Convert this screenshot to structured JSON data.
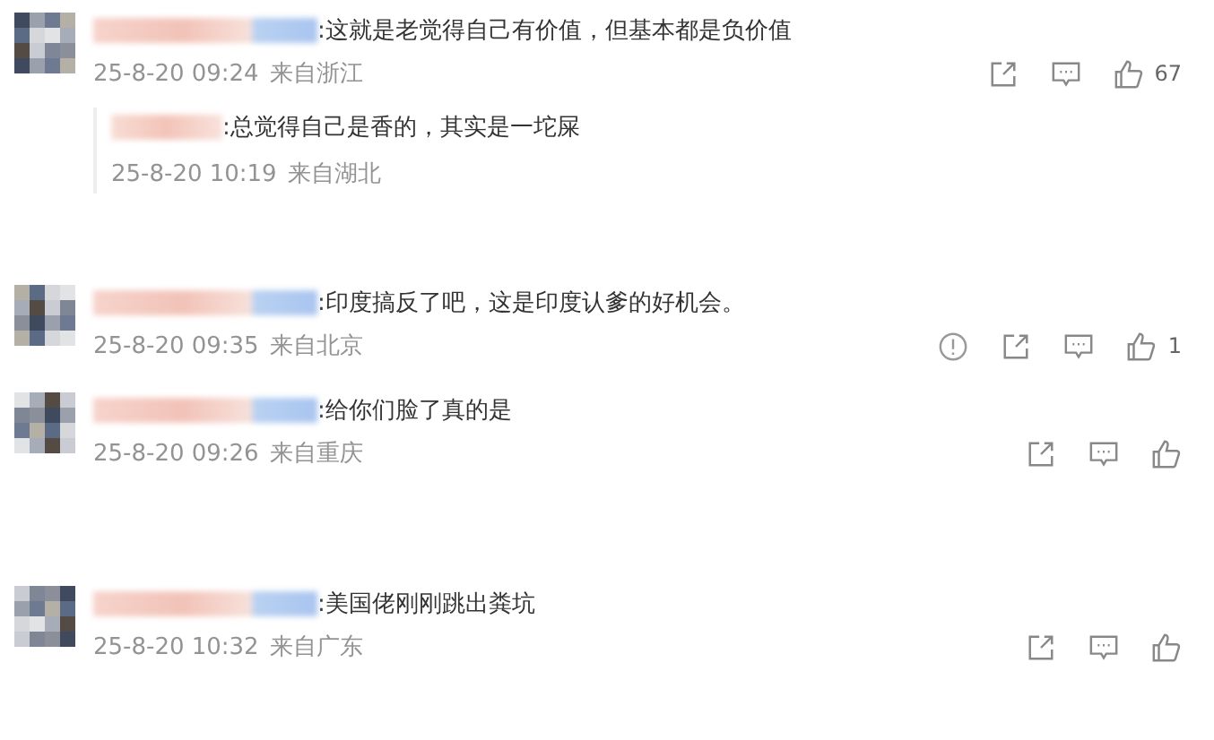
{
  "comments": [
    {
      "text": ":这就是老觉得自己有价值，但基本都是负价值",
      "time": "25-8-20 09:24",
      "location": "来自浙江",
      "actions": [
        {
          "kind": "share"
        },
        {
          "kind": "comment"
        },
        {
          "kind": "like",
          "count": "67"
        }
      ],
      "replies": [
        {
          "text": ":总觉得自己是香的，其实是一坨屎",
          "time": "25-8-20 10:19",
          "location": "来自湖北"
        }
      ]
    },
    {
      "text": ":印度搞反了吧，这是印度认爹的好机会。",
      "time": "25-8-20 09:35",
      "location": "来自北京",
      "actions": [
        {
          "kind": "report"
        },
        {
          "kind": "share"
        },
        {
          "kind": "comment"
        },
        {
          "kind": "like",
          "count": "1"
        }
      ]
    },
    {
      "text": ":给你们脸了真的是",
      "time": "25-8-20 09:26",
      "location": "来自重庆",
      "actions": [
        {
          "kind": "share"
        },
        {
          "kind": "comment"
        },
        {
          "kind": "like"
        }
      ]
    },
    {
      "text": ":美国佬刚刚跳出粪坑",
      "time": "25-8-20 10:32",
      "location": "来自广东",
      "actions": [
        {
          "kind": "share"
        },
        {
          "kind": "comment"
        },
        {
          "kind": "like"
        }
      ]
    }
  ]
}
